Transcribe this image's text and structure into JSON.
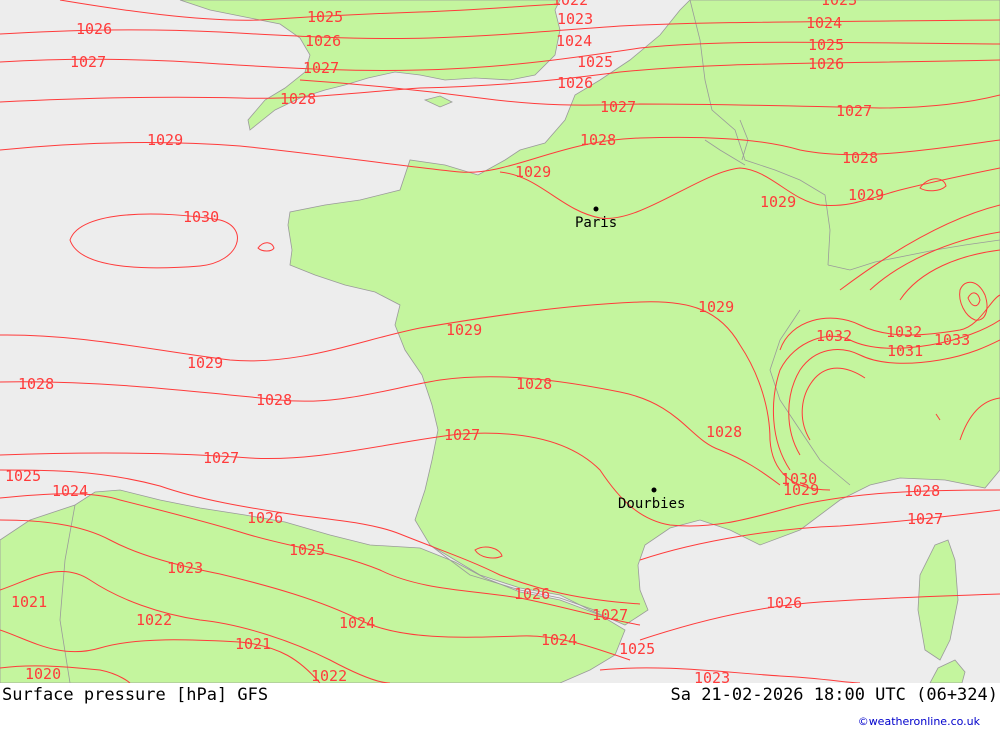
{
  "title": "Surface pressure [hPa] GFS",
  "datetime": "Sa 21-02-2026 18:00 UTC (06+324)",
  "credit": "©weatheronline.co.uk",
  "colors": {
    "land": "#c4f59e",
    "sea": "#ededed",
    "isobar": "#ff3b3b",
    "border": "#9a9a9a",
    "text": "#000000",
    "credit": "#0000cc"
  },
  "cities": [
    {
      "name": "Paris"
    },
    {
      "name": "Dourbies"
    }
  ],
  "isobar_labels": {
    "l1022a": "1022",
    "l1023a": "1023",
    "l1025a": "1025",
    "l1026a": "1026",
    "l1026b": "1026",
    "l1027a": "1027",
    "l1027b": "1027",
    "l1028a": "1028",
    "l1029a": "1029",
    "l1030a": "1030",
    "l1029b": "1029",
    "l1028b": "1028",
    "l1028c": "1028",
    "l1027c": "1027",
    "l1025b": "1025",
    "l1024a": "1024",
    "l1026c": "1026",
    "l1025c": "1025",
    "l1023b": "1023",
    "l1021a": "1021",
    "l1022b": "1022",
    "l1024b": "1024",
    "l1021b": "1021",
    "l1020a": "1020",
    "l1022c": "1022",
    "l1023c": "1023",
    "l1024c": "1024",
    "l1025d": "1025",
    "l1026d": "1026",
    "l1027d": "1027",
    "l1028d": "1028",
    "l1029c": "1029",
    "l1028e": "1028",
    "l1029d": "1029",
    "l1029e": "1029",
    "l1029f": "1029",
    "l1032a": "1032",
    "l1032b": "1032",
    "l1031a": "1031",
    "l1033a": "1033",
    "l1030b": "1030",
    "l1029g": "1029",
    "l1028f": "1028",
    "l1027e": "1027",
    "l1026e": "1026",
    "l1027f": "1027",
    "l1026f": "1026",
    "l1024d": "1024",
    "l1025e": "1025",
    "l1023d": "1023",
    "l1028g": "1028",
    "l1029h": "1029",
    "l1024e": "1024",
    "l1025f": "1025",
    "l1026g": "1026",
    "l1027g": "1027",
    "l1028h": "1028",
    "l1025g": "1025"
  }
}
